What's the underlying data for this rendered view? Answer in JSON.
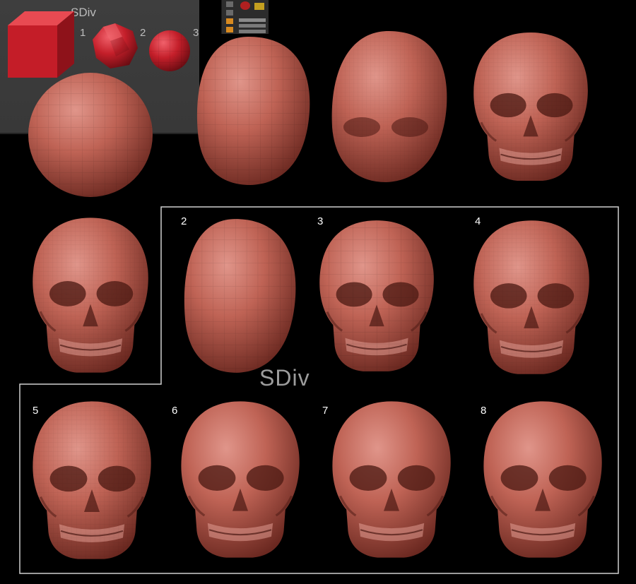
{
  "header": {
    "label": "SDiv"
  },
  "primitives": [
    {
      "label": "1"
    },
    {
      "label": "2"
    },
    {
      "label": "3"
    }
  ],
  "framed": {
    "caption": "SDiv",
    "steps": [
      {
        "label": "2"
      },
      {
        "label": "3"
      },
      {
        "label": "4"
      },
      {
        "label": "5"
      },
      {
        "label": "6"
      },
      {
        "label": "7"
      },
      {
        "label": "8"
      }
    ]
  },
  "colors": {
    "panel": "#3b3b3b",
    "primitive_red": "#c8202a",
    "clay_light": "#d8867a",
    "clay_mid": "#b6584b",
    "clay_dark": "#6e2a22",
    "frame": "#d0d0d0"
  }
}
